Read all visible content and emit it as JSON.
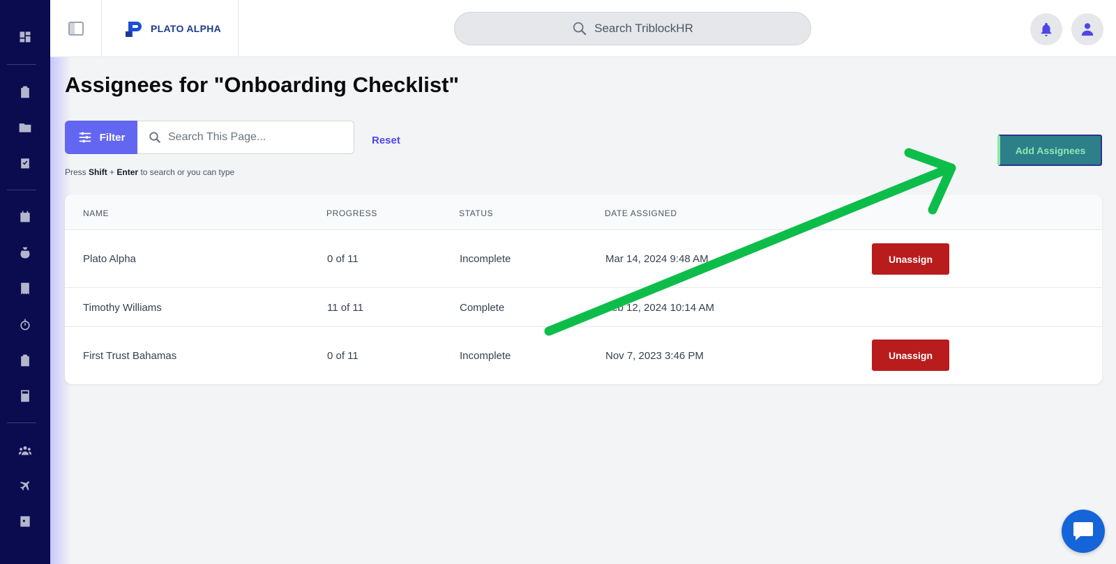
{
  "app": {
    "logo_text": "PLATO ALPHA",
    "search_placeholder": "Search TriblockHR"
  },
  "sidebar": {
    "icons": [
      "dashboard-icon",
      "clipboard-icon",
      "folder-icon",
      "task-check-icon",
      "calendar-icon",
      "money-bag-icon",
      "receipt-icon",
      "timer-icon",
      "clipboard-list-icon",
      "calculator-icon",
      "people-icon",
      "airplane-icon",
      "contact-card-icon"
    ]
  },
  "page": {
    "title": "Assignees for \"Onboarding Checklist\"",
    "filter_label": "Filter",
    "search_placeholder": "Search This Page...",
    "reset_label": "Reset",
    "hint_prefix": "Press",
    "hint_key1": "Shift",
    "hint_plus": "+",
    "hint_key2": "Enter",
    "hint_suffix": "to search or you can type",
    "add_button_label": "Add Assignees"
  },
  "table": {
    "headers": {
      "name": "NAME",
      "progress": "PROGRESS",
      "status": "STATUS",
      "date": "DATE ASSIGNED"
    },
    "rows": [
      {
        "name": "Plato Alpha",
        "progress": "0 of 11",
        "status": "Incomplete",
        "date": "Mar 14, 2024 9:48 AM",
        "action": "Unassign"
      },
      {
        "name": "Timothy Williams",
        "progress": "11 of 11",
        "status": "Complete",
        "date": "Feb 12, 2024 10:14 AM",
        "action": ""
      },
      {
        "name": "First Trust Bahamas",
        "progress": "0 of 11",
        "status": "Incomplete",
        "date": "Nov 7, 2023 3:46 PM",
        "action": "Unassign"
      }
    ]
  },
  "colors": {
    "sidebar": "#0b0b4f",
    "accent": "#6366f1",
    "danger": "#b91c1c",
    "annotation_arrow": "#0dbd4a"
  }
}
